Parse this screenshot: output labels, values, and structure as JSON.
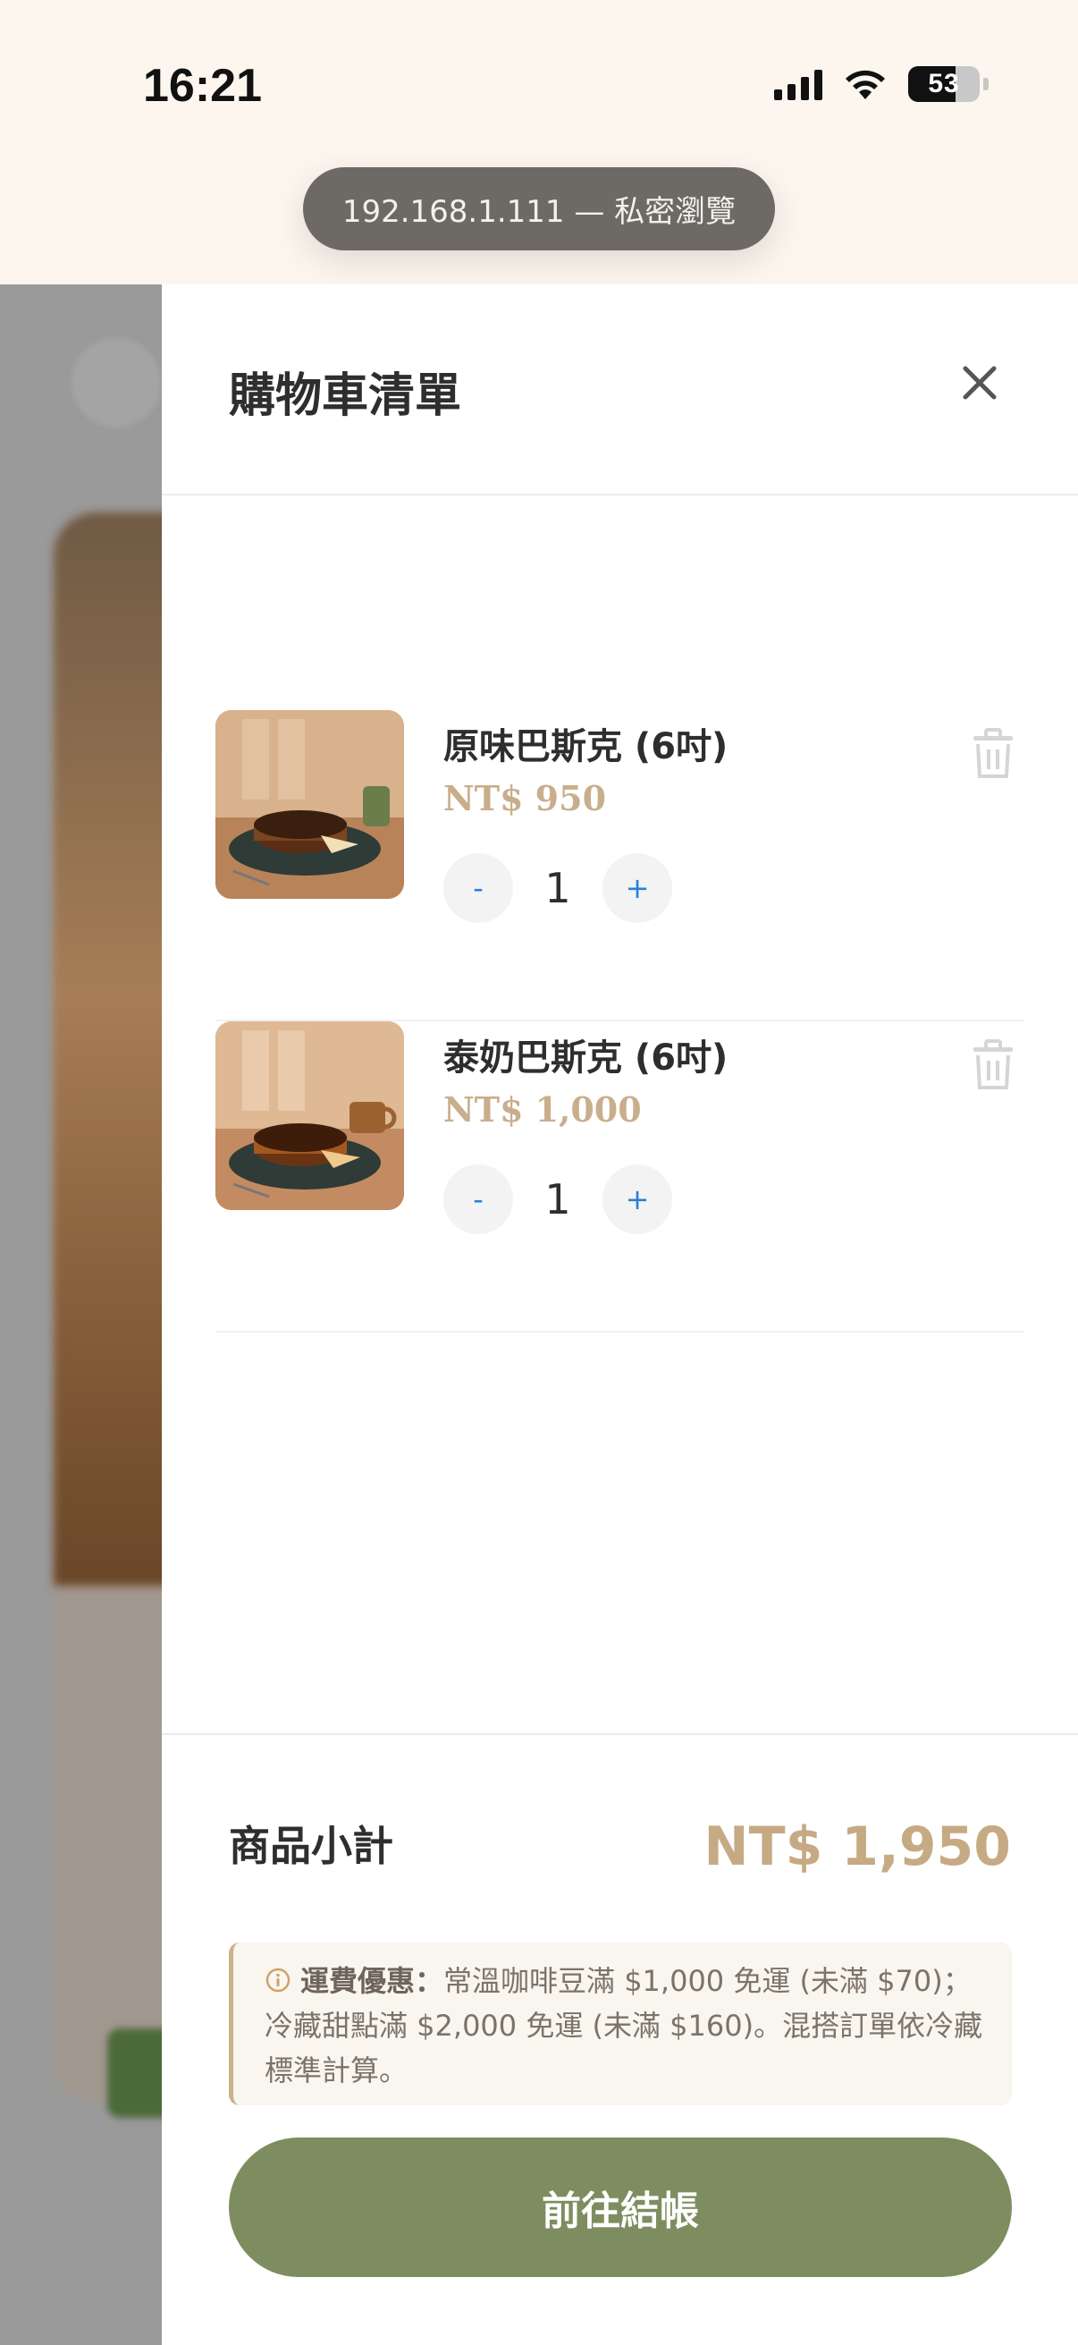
{
  "status_bar": {
    "time": "16:21",
    "battery": "53"
  },
  "browser": {
    "url": "192.168.1.111 — 私密瀏覽"
  },
  "cart": {
    "title": "購物車清單",
    "items": [
      {
        "name": "原味巴斯克 (6吋)",
        "price": "NT$ 950",
        "quantity": "1",
        "minus": "-",
        "plus": "+"
      },
      {
        "name": "泰奶巴斯克 (6吋)",
        "price": "NT$ 1,000",
        "quantity": "1",
        "minus": "-",
        "plus": "+"
      }
    ],
    "subtotal_label": "商品小計",
    "subtotal_value": "NT$ 1,950",
    "shipping_notice_title": "運費優惠：",
    "shipping_notice_text": "常溫咖啡豆滿 $1,000 免運 (未滿 $70)；冷藏甜點滿 $2,000 免運 (未滿 $160)。混搭訂單依冷藏標準計算。",
    "checkout_label": "前往結帳"
  },
  "colors": {
    "accent_gold": "#c6aa84",
    "checkout_green": "#7e8d5f",
    "qty_blue": "#2a7fd4",
    "backdrop": "#9a9a9a"
  }
}
